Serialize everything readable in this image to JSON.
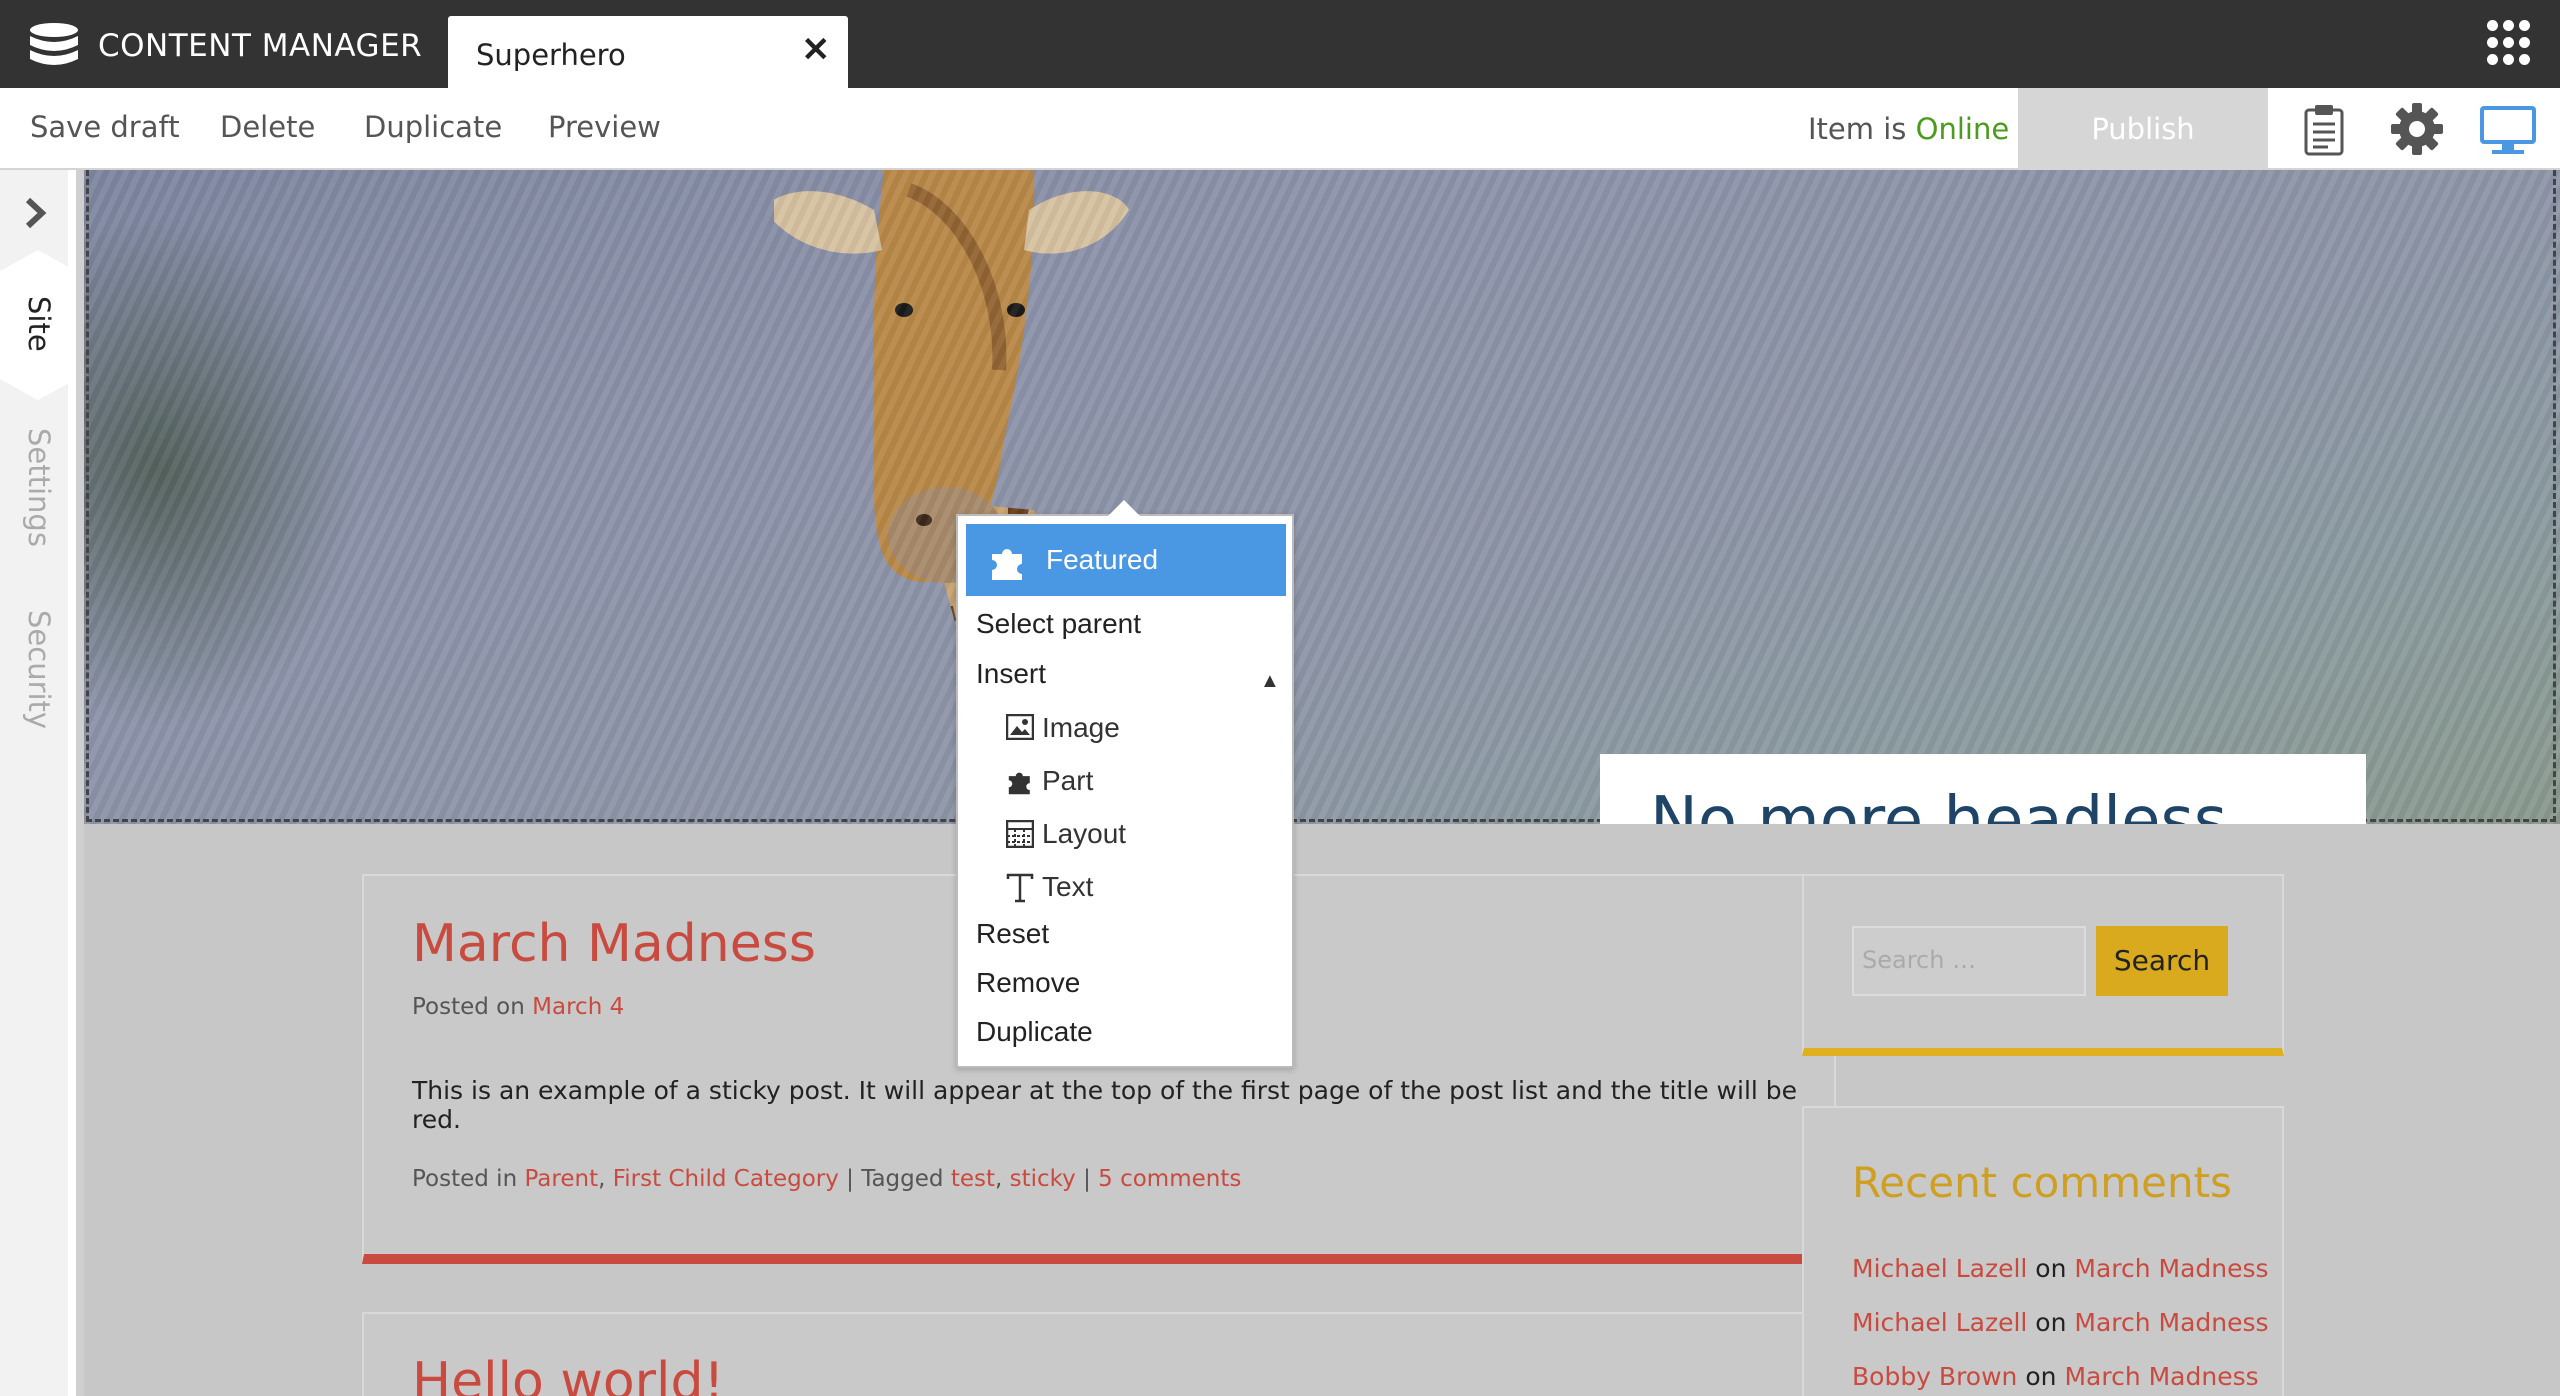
{
  "app": {
    "title": "CONTENT MANAGER"
  },
  "tab": {
    "label": "Superhero",
    "close": "✕"
  },
  "toolbar": {
    "actions": [
      "Save draft",
      "Delete",
      "Duplicate",
      "Preview"
    ],
    "status_prefix": "Item is ",
    "status_value": "Online",
    "publish_label": "Publish"
  },
  "sidebar": {
    "tabs": [
      "Site",
      "Settings",
      "Security"
    ]
  },
  "hero": {
    "caption": "No more headless Giraffe"
  },
  "context_menu": {
    "header": "Featured",
    "items": [
      "Select parent",
      "Insert",
      "Reset",
      "Remove",
      "Duplicate"
    ],
    "insert_sub": [
      "Image",
      "Part",
      "Layout",
      "Text"
    ]
  },
  "post": {
    "title": "March Madness",
    "meta_prefix": "Posted on ",
    "meta_date": "March 4",
    "excerpt": "This is an example of a sticky post. It will appear at the top of the first page of the post list and the title will be red.",
    "footer": {
      "posted_in": "Posted in ",
      "cat1": "Parent",
      "sep1": ", ",
      "cat2": "First Child Category",
      "tagged": " | Tagged ",
      "tag1": "test",
      "sep2": ", ",
      "tag2": "sticky",
      "sep3": " | ",
      "comments": "5 comments"
    }
  },
  "post2": {
    "title": "Hello world!"
  },
  "search": {
    "placeholder": "Search …",
    "button": "Search"
  },
  "recent_comments": {
    "title": "Recent comments",
    "items": [
      {
        "author": "Michael Lazell",
        "on": " on ",
        "post": "March Madness"
      },
      {
        "author": "Michael Lazell",
        "on": " on ",
        "post": "March Madness"
      },
      {
        "author": "Bobby Brown",
        "on": " on ",
        "post": "March Madness"
      }
    ]
  },
  "colors": {
    "topbar": "#333333",
    "accent_blue": "#4a97e4",
    "online_green": "#4a9b1e",
    "post_red": "#c94a3f",
    "caption_navy": "#1e4467",
    "search_gold": "#d9aa1e"
  },
  "icons": [
    "database-icon",
    "close-icon",
    "apps-grid-icon",
    "clipboard-icon",
    "gear-icon",
    "monitor-icon",
    "chevron-right-icon",
    "puzzle-icon",
    "image-icon",
    "layout-icon",
    "text-icon",
    "caret-up-icon"
  ]
}
